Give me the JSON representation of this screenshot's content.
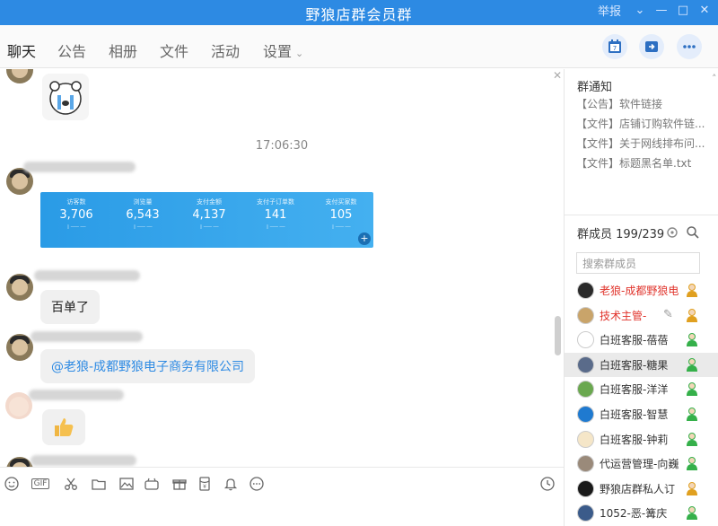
{
  "window": {
    "title": "野狼店群会员群",
    "report_label": "举报",
    "controls": [
      "chevron-down-icon",
      "minimize-icon",
      "maximize-icon",
      "close-icon"
    ]
  },
  "tabs": [
    {
      "label": "聊天",
      "active": true
    },
    {
      "label": "公告"
    },
    {
      "label": "相册"
    },
    {
      "label": "文件"
    },
    {
      "label": "活动"
    },
    {
      "label": "设置"
    }
  ],
  "actions": {
    "calendar_number": "7"
  },
  "chat": {
    "timestamp": "17:06:30",
    "dashboard": {
      "metrics": [
        {
          "label": "访客数",
          "value": "3,706"
        },
        {
          "label": "浏览量",
          "value": "6,543"
        },
        {
          "label": "支付金额",
          "value": "4,137"
        },
        {
          "label": "支付子订单数",
          "value": "141"
        },
        {
          "label": "支付买家数",
          "value": "105"
        }
      ],
      "zoom_icon": "+"
    },
    "messages": [
      {
        "text": "百单了"
      },
      {
        "text": "@老狼-成都野狼电子商务有限公司"
      }
    ]
  },
  "toolbar": {
    "gif_label": "GIF"
  },
  "panel": {
    "notice_title": "群通知",
    "notices": [
      "【公告】软件链接",
      "【文件】店铺订购软件链...",
      "【文件】关于网线排布问...",
      "【文件】标题黑名单.txt"
    ],
    "members_title": "群成员 199/239",
    "search_placeholder": "搜索群成员",
    "members": [
      {
        "name": "老狼-成都野狼电",
        "red": true,
        "avatar_color": "#2b2b2b",
        "person_color": "#e0a020"
      },
      {
        "name": "技术主管-",
        "red": true,
        "avatar_color": "#c9a46a",
        "person_color": "#e0a020"
      },
      {
        "name": "白班客服-蓓蓓",
        "avatar_color": "#ffffff",
        "person_color": "#35b04a"
      },
      {
        "name": "白班客服-糖果",
        "avatar_color": "#5a6b8a",
        "person_color": "#35b04a",
        "selected": true
      },
      {
        "name": "白班客服-洋洋",
        "avatar_color": "#6aa84f",
        "person_color": "#35b04a"
      },
      {
        "name": "白班客服-智慧",
        "avatar_color": "#1f7ad0",
        "person_color": "#35b04a"
      },
      {
        "name": "白班客服-钟莉",
        "avatar_color": "#f5e6c8",
        "person_color": "#35b04a"
      },
      {
        "name": "代运营管理-向巍",
        "avatar_color": "#9a8a7a",
        "person_color": "#35b04a"
      },
      {
        "name": "野狼店群私人订",
        "avatar_color": "#1a1a1a",
        "person_color": "#e0a020"
      },
      {
        "name": "1052-恶-篝庆",
        "avatar_color": "#3b5b8a",
        "person_color": "#35b04a"
      }
    ]
  }
}
